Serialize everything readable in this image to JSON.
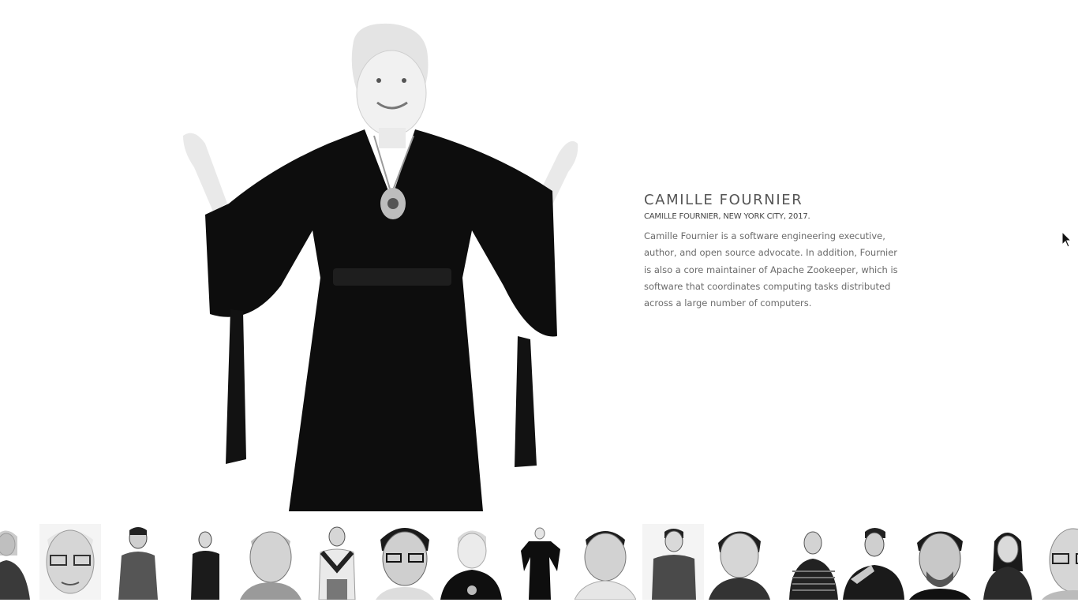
{
  "person": {
    "name": "CAMILLE FOURNIER",
    "caption": "CAMILLE FOURNIER, NEW YORK CITY, 2017.",
    "bio": "Camille Fournier is a software engineering executive, author, and open source advocate. In addition, Fournier is also a core maintainer of Apache Zookeeper, which is software that coordinates computing tasks distributed across a large number of computers."
  },
  "thumbnails": [
    {
      "kind": "woman-half"
    },
    {
      "kind": "old-glasses"
    },
    {
      "kind": "man-standing"
    },
    {
      "kind": "man-full"
    },
    {
      "kind": "old-man"
    },
    {
      "kind": "man-scarf"
    },
    {
      "kind": "man-glasses-close"
    },
    {
      "kind": "camille-close"
    },
    {
      "kind": "camille-full"
    },
    {
      "kind": "old-man-2"
    },
    {
      "kind": "woman-standing"
    },
    {
      "kind": "woman-short-hair"
    },
    {
      "kind": "man-striped"
    },
    {
      "kind": "man-beard-arms"
    },
    {
      "kind": "man-beard"
    },
    {
      "kind": "woman-dark-hair"
    },
    {
      "kind": "old-glasses-2"
    }
  ]
}
